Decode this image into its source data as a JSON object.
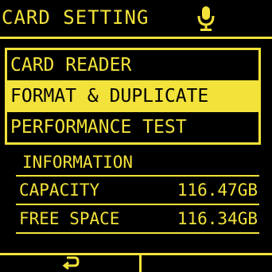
{
  "header": {
    "title": "CARD SETTING",
    "icon": "microphone-icon"
  },
  "menu": {
    "items": [
      {
        "label": "CARD READER",
        "selected": false
      },
      {
        "label": "FORMAT & DUPLICATE",
        "selected": true
      },
      {
        "label": "PERFORMANCE TEST",
        "selected": false
      }
    ]
  },
  "info": {
    "title": "INFORMATION",
    "capacity_label": "CAPACITY",
    "capacity_value": "116.47GB",
    "free_label": "FREE SPACE",
    "free_value": "116.34GB"
  },
  "footer": {
    "back_icon": "return-arrow-icon"
  },
  "colors": {
    "accent": "#f2e23a",
    "background": "#000000"
  }
}
